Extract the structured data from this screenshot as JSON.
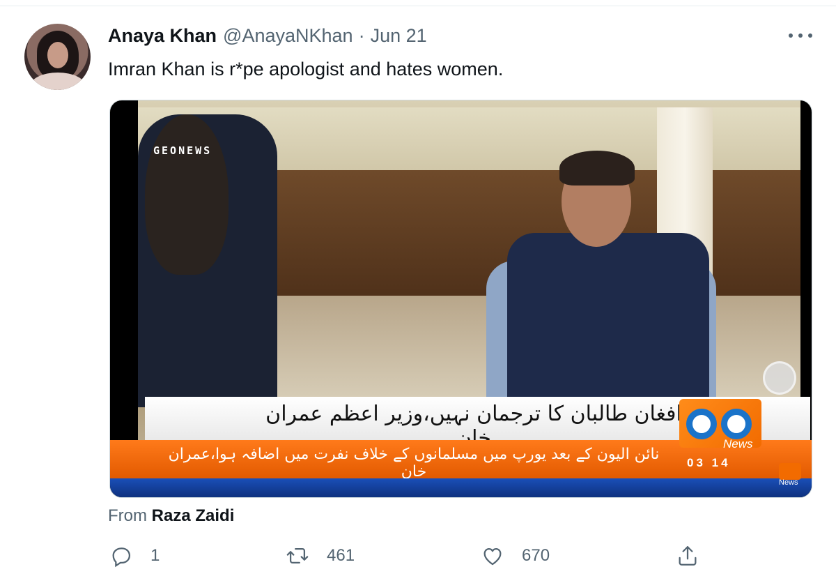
{
  "tweet": {
    "author_name": "Anaya Khan",
    "handle": "@AnayaNKhan",
    "separator": "·",
    "date": "Jun 21",
    "text": "Imran Khan is r*pe apologist and hates women.",
    "more_icon": "more-horizontal-icon"
  },
  "media": {
    "watermark": "GEONEWS",
    "headline_urdu": "افغان طالبان کا ترجمان نہیں،وزیر اعظم عمران خان",
    "subline_urdu": "نائن الیون کے بعد یورپ میں مسلمانوں کے خلاف نفرت میں اضافہ ہوا،عمران خان",
    "channel_label": "News",
    "ticker_time": "03 14",
    "corner_label": "News"
  },
  "attribution": {
    "prefix": "From",
    "source": "Raza Zaidi"
  },
  "actions": {
    "reply": {
      "icon": "reply-icon",
      "count": "1"
    },
    "retweet": {
      "icon": "retweet-icon",
      "count": "461"
    },
    "like": {
      "icon": "heart-icon",
      "count": "670"
    },
    "share": {
      "icon": "share-icon"
    }
  },
  "colors": {
    "text_primary": "#0f1419",
    "text_secondary": "#536471",
    "divider": "#e6ecf0",
    "ticker_orange": "#f26b00",
    "ticker_blue": "#1a4fb8"
  }
}
